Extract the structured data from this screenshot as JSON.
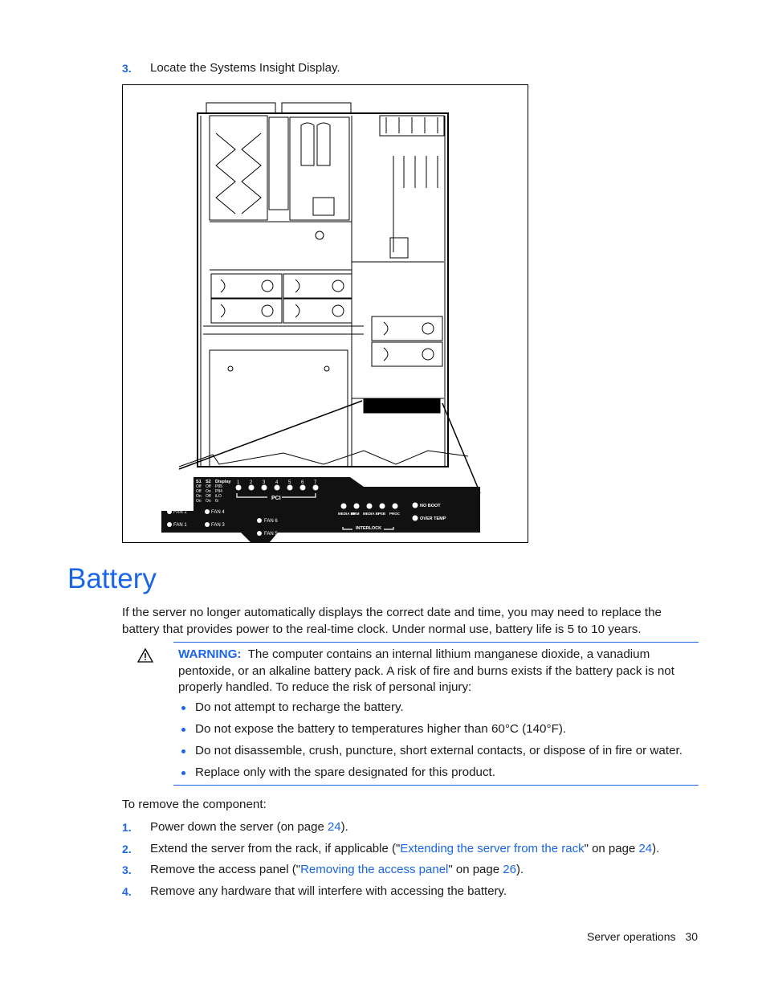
{
  "pre_steps": [
    {
      "number": "3.",
      "text": "Locate the Systems Insight Display."
    }
  ],
  "figure": {
    "caption_hidden": "",
    "panel": {
      "switch_table": {
        "headers": [
          "S1",
          "S2",
          "Display"
        ],
        "rows": [
          [
            "Off",
            "Off",
            "P85"
          ],
          [
            "Off",
            "On",
            "P84"
          ],
          [
            "On",
            "Off",
            "iLO"
          ],
          [
            "On",
            "On",
            "6i"
          ]
        ]
      },
      "pci_numbers": [
        "1",
        "2",
        "3",
        "4",
        "5",
        "6",
        "7"
      ],
      "pci_label": "PCI",
      "fans": [
        "FAN 2",
        "FAN 4",
        "FAN 1",
        "FAN 3",
        "FAN 6",
        "FAN 5"
      ],
      "interlock_items": [
        "MEDIA BP",
        "MEM",
        "MEDIA BP",
        "FSB",
        "PROC"
      ],
      "interlock_label": "INTERLOCK",
      "status_items": [
        "NO BOOT",
        "OVER TEMP"
      ]
    }
  },
  "section": {
    "title": "Battery",
    "intro": "If the server no longer automatically displays the correct date and time, you may need to replace the battery that provides power to the real-time clock. Under normal use, battery life is 5 to 10 years."
  },
  "warning": {
    "label": "WARNING:",
    "text": "The computer contains an internal lithium manganese dioxide, a vanadium pentoxide, or an alkaline battery pack. A risk of fire and burns exists if the battery pack is not properly handled. To reduce the risk of personal injury:",
    "bullets": [
      "Do not attempt to recharge the battery.",
      "Do not expose the battery to temperatures higher than 60°C (140°F).",
      "Do not disassemble, crush, puncture, short external contacts, or dispose of in fire or water.",
      "Replace only with the spare designated for this product."
    ]
  },
  "remove": {
    "intro": "To remove the component:",
    "steps": [
      {
        "number": "1.",
        "before": "Power down the server (on page ",
        "link": "",
        "middle": "",
        "page": "24",
        "after": ")."
      },
      {
        "number": "2.",
        "before": "Extend the server from the rack, if applicable (\"",
        "link": "Extending the server from the rack",
        "middle": "\" on page ",
        "page": "24",
        "after": ")."
      },
      {
        "number": "3.",
        "before": "Remove the access panel (\"",
        "link": "Removing the access panel",
        "middle": "\" on page ",
        "page": "26",
        "after": ")."
      },
      {
        "number": "4.",
        "before": "Remove any hardware that will interfere with accessing the battery.",
        "link": "",
        "middle": "",
        "page": "",
        "after": ""
      }
    ]
  },
  "footer": {
    "section": "Server operations",
    "page": "30"
  }
}
